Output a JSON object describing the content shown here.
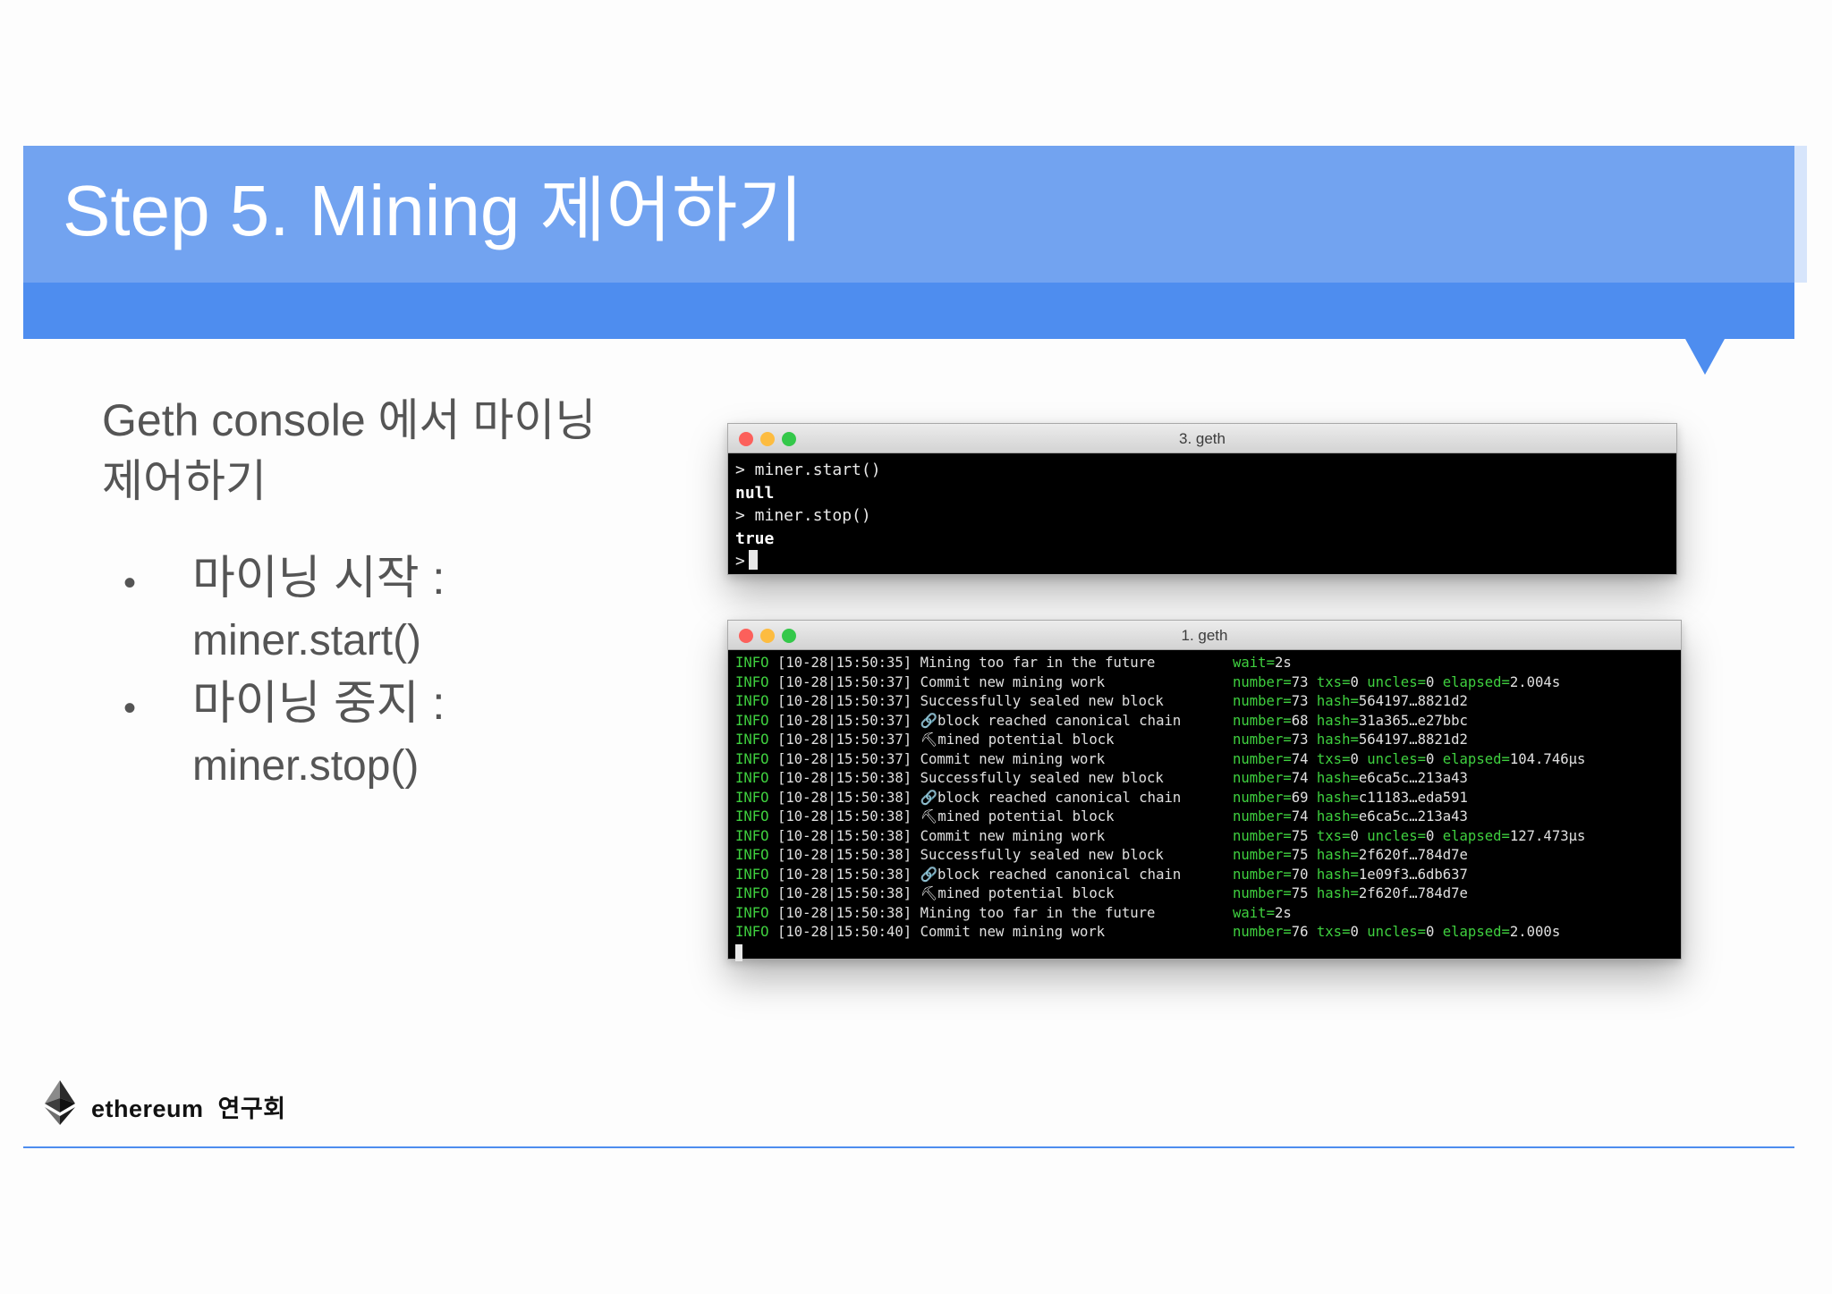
{
  "slide": {
    "title": "Step 5. Mining 제어하기",
    "intro": "Geth console 에서 마이닝 제어하기",
    "bullets": [
      {
        "label": "마이닝 시작 :",
        "command": "miner.start()"
      },
      {
        "label": "마이닝 중지 :",
        "command": "miner.stop()"
      }
    ],
    "colors": {
      "header_light": "#72a3f0",
      "header_dark": "#4e8def",
      "text": "#555555"
    }
  },
  "terminal_top": {
    "title": "3. geth",
    "lines": [
      {
        "text": "> miner.start()",
        "bold": false
      },
      {
        "text": "null",
        "bold": true
      },
      {
        "text": "> miner.stop()",
        "bold": false
      },
      {
        "text": "true",
        "bold": true
      }
    ],
    "prompt": ">"
  },
  "terminal_bottom": {
    "title": "1. geth",
    "logs": [
      {
        "level": "INFO",
        "time": "[10-28|15:50:35]",
        "msg": "Mining too far in the future",
        "ctx": [
          [
            "wait",
            "2s"
          ]
        ]
      },
      {
        "level": "INFO",
        "time": "[10-28|15:50:37]",
        "msg": "Commit new mining work",
        "ctx": [
          [
            "number",
            "73"
          ],
          [
            "txs",
            "0"
          ],
          [
            "uncles",
            "0"
          ],
          [
            "elapsed",
            "2.004s"
          ]
        ]
      },
      {
        "level": "INFO",
        "time": "[10-28|15:50:37]",
        "msg": "Successfully sealed new block",
        "ctx": [
          [
            "number",
            "73"
          ],
          [
            "hash",
            "564197…8821d2"
          ]
        ]
      },
      {
        "level": "INFO",
        "time": "[10-28|15:50:37]",
        "msg": "🔗block reached canonical chain",
        "ctx": [
          [
            "number",
            "68"
          ],
          [
            "hash",
            "31a365…e27bbc"
          ]
        ]
      },
      {
        "level": "INFO",
        "time": "[10-28|15:50:37]",
        "msg": "⛏mined potential block",
        "ctx": [
          [
            "number",
            "73"
          ],
          [
            "hash",
            "564197…8821d2"
          ]
        ]
      },
      {
        "level": "INFO",
        "time": "[10-28|15:50:37]",
        "msg": "Commit new mining work",
        "ctx": [
          [
            "number",
            "74"
          ],
          [
            "txs",
            "0"
          ],
          [
            "uncles",
            "0"
          ],
          [
            "elapsed",
            "104.746µs"
          ]
        ]
      },
      {
        "level": "INFO",
        "time": "[10-28|15:50:38]",
        "msg": "Successfully sealed new block",
        "ctx": [
          [
            "number",
            "74"
          ],
          [
            "hash",
            "e6ca5c…213a43"
          ]
        ]
      },
      {
        "level": "INFO",
        "time": "[10-28|15:50:38]",
        "msg": "🔗block reached canonical chain",
        "ctx": [
          [
            "number",
            "69"
          ],
          [
            "hash",
            "c11183…eda591"
          ]
        ]
      },
      {
        "level": "INFO",
        "time": "[10-28|15:50:38]",
        "msg": "⛏mined potential block",
        "ctx": [
          [
            "number",
            "74"
          ],
          [
            "hash",
            "e6ca5c…213a43"
          ]
        ]
      },
      {
        "level": "INFO",
        "time": "[10-28|15:50:38]",
        "msg": "Commit new mining work",
        "ctx": [
          [
            "number",
            "75"
          ],
          [
            "txs",
            "0"
          ],
          [
            "uncles",
            "0"
          ],
          [
            "elapsed",
            "127.473µs"
          ]
        ]
      },
      {
        "level": "INFO",
        "time": "[10-28|15:50:38]",
        "msg": "Successfully sealed new block",
        "ctx": [
          [
            "number",
            "75"
          ],
          [
            "hash",
            "2f620f…784d7e"
          ]
        ]
      },
      {
        "level": "INFO",
        "time": "[10-28|15:50:38]",
        "msg": "🔗block reached canonical chain",
        "ctx": [
          [
            "number",
            "70"
          ],
          [
            "hash",
            "1e09f3…6db637"
          ]
        ]
      },
      {
        "level": "INFO",
        "time": "[10-28|15:50:38]",
        "msg": "⛏mined potential block",
        "ctx": [
          [
            "number",
            "75"
          ],
          [
            "hash",
            "2f620f…784d7e"
          ]
        ]
      },
      {
        "level": "INFO",
        "time": "[10-28|15:50:38]",
        "msg": "Mining too far in the future",
        "ctx": [
          [
            "wait",
            "2s"
          ]
        ]
      },
      {
        "level": "INFO",
        "time": "[10-28|15:50:40]",
        "msg": "Commit new mining work",
        "ctx": [
          [
            "number",
            "76"
          ],
          [
            "txs",
            "0"
          ],
          [
            "uncles",
            "0"
          ],
          [
            "elapsed",
            "2.000s"
          ]
        ]
      }
    ]
  },
  "footer": {
    "brand": "ethereum",
    "brand_suffix": "연구회",
    "logo_icon": "ethereum-diamond-icon"
  }
}
